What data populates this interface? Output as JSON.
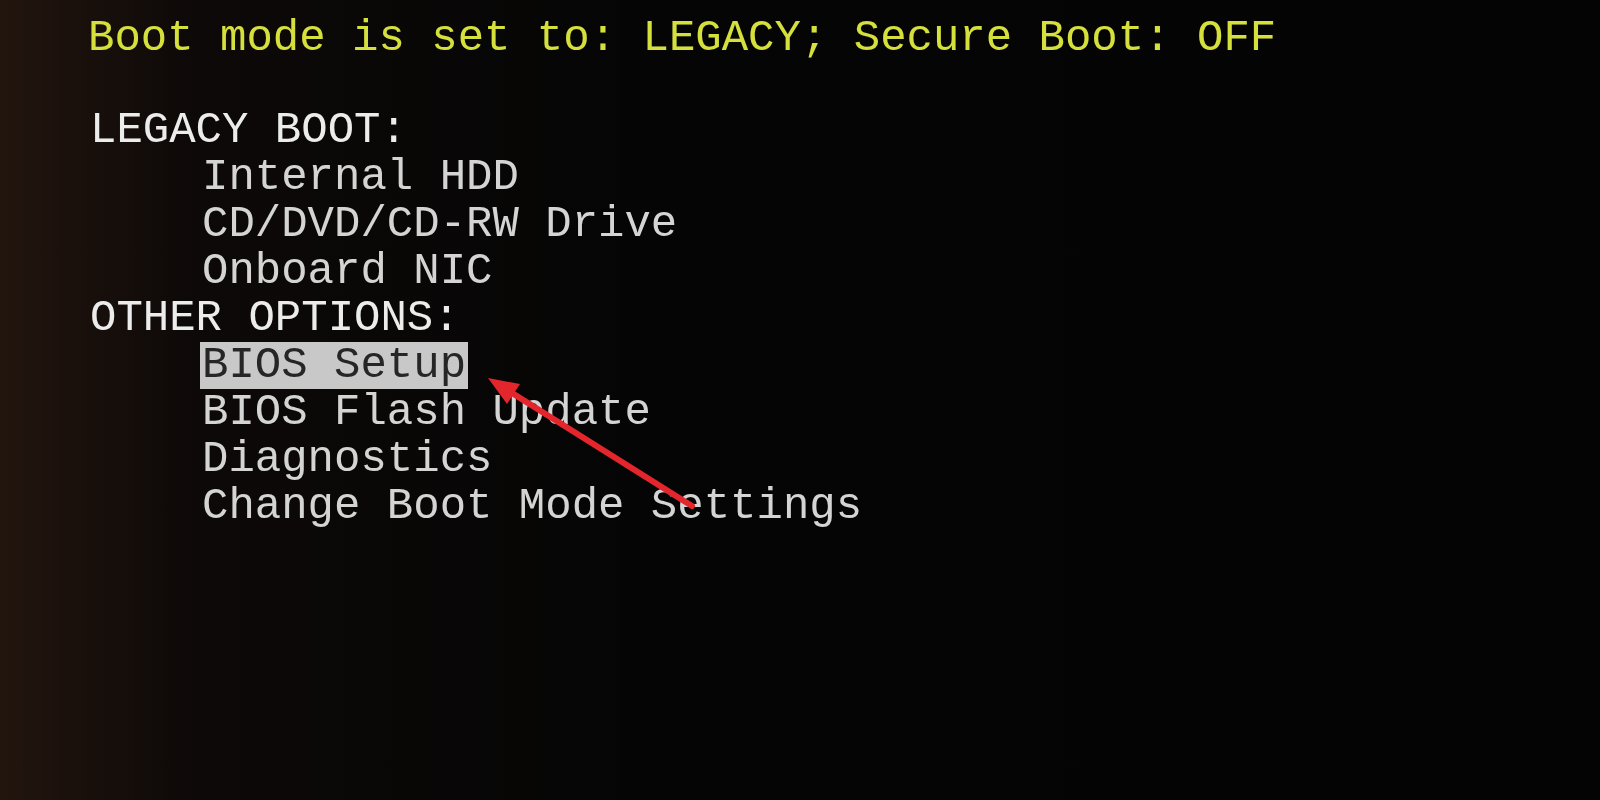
{
  "status_line": {
    "text": "Boot mode is set to: LEGACY; Secure Boot: OFF"
  },
  "sections": [
    {
      "title": "LEGACY BOOT:",
      "items": [
        {
          "label": "Internal HDD",
          "selected": false
        },
        {
          "label": "CD/DVD/CD-RW Drive",
          "selected": false
        },
        {
          "label": "Onboard NIC",
          "selected": false
        }
      ]
    },
    {
      "title": "OTHER OPTIONS:",
      "items": [
        {
          "label": "BIOS Setup",
          "selected": true
        },
        {
          "label": "BIOS Flash Update",
          "selected": false
        },
        {
          "label": "Diagnostics",
          "selected": false
        },
        {
          "label": "Change Boot Mode Settings",
          "selected": false
        }
      ]
    }
  ]
}
